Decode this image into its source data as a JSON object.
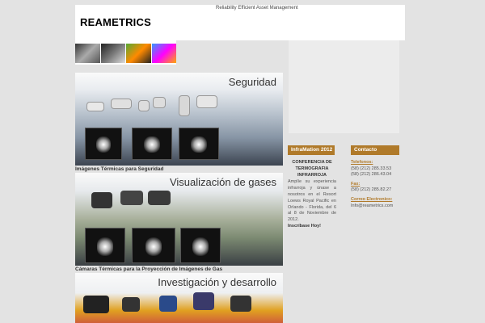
{
  "header": {
    "tagline": "Reliability Efficient Asset Management",
    "logo": "REAMETRICS"
  },
  "panels": [
    {
      "title": "Seguridad",
      "caption": "Imágenes Térmicas para Seguridad"
    },
    {
      "title": "Visualización de gases",
      "caption": "Cámaras Térmicas para la Proyección de Imágenes de Gas"
    },
    {
      "title": "Investigación y desarrollo"
    }
  ],
  "news": {
    "heading": "InfraMation 2012",
    "subheading": "CONFERENCIA DE TERMOGRAFIA INFRARROJA",
    "body": "Amplíe su experiencia infrarroja y únase a nosotros en el Resort Loews Royal Pacific en Orlando - Florida, del 6 al 8 de Noviembre de 2012.",
    "cta": "Inscríbase Hoy!"
  },
  "contact": {
    "heading": "Contacto",
    "phones_label": "Telefonos:",
    "phones": [
      "(58) (212) 285.33.53",
      "(58) (212) 286.43.04"
    ],
    "fax_label": "Fax:",
    "fax": "(58) (212) 285.82.27",
    "email_label": "Correo Electronico:",
    "email": "Info@reametrics.com"
  },
  "colors": {
    "accent": "#b07a2a",
    "background": "#e3e3e3"
  }
}
